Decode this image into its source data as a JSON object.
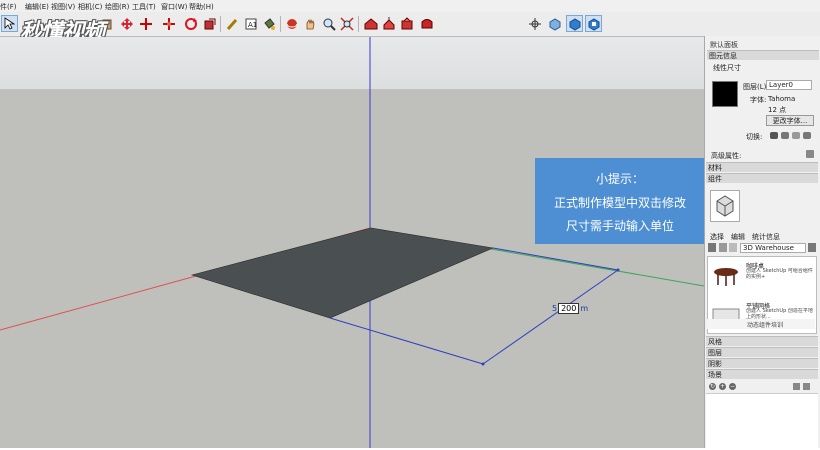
{
  "menu": [
    "件(F)",
    "编辑(E)",
    "视图(V)",
    "相机(C)",
    "绘图(R)",
    "工具(T)",
    "窗口(W)",
    "帮助(H)"
  ],
  "watermark": "秒懂视频",
  "hint": {
    "title": "小提示：",
    "line1": "正式制作模型中双击修改",
    "line2": "尺寸需手动输入单位"
  },
  "dimension": {
    "prefix": "5",
    "value": "200",
    "unit": "m"
  },
  "panel": {
    "title": "默认面板",
    "entity_info": {
      "header": "图元信息",
      "type": "线性尺寸",
      "layer_label": "图层(L):",
      "layer_value": "Layer0",
      "font_label": "字体:",
      "font_value": "Tahoma",
      "size_value": "12 点",
      "change_font_button": "更改字体...",
      "toggle_label": "切换:",
      "advanced_label": "高级属性:"
    },
    "materials_header": "材料",
    "components": {
      "header": "组件",
      "tabs": [
        "选择",
        "编辑",
        "统计信息"
      ],
      "search_value": "3D Warehouse",
      "items": [
        {
          "name": "咖啡桌",
          "desc": "创建人 SketchUp 可组合组件的实例+"
        },
        {
          "name": "平铺网格",
          "desc": "创建人 SketchUp 创造在平地上的形状..."
        }
      ],
      "footer": "动态组件培训"
    },
    "sections": [
      "风格",
      "图层",
      "阴影",
      "场景"
    ]
  },
  "colors": {
    "hint_bg": "#4e8fd3",
    "sky": "#e8eaeb",
    "ground": "#bfc0bc",
    "rect": "#4a4f52",
    "axis_red": "#e05050",
    "axis_green": "#3aa655",
    "axis_blue": "#3a3acc"
  }
}
